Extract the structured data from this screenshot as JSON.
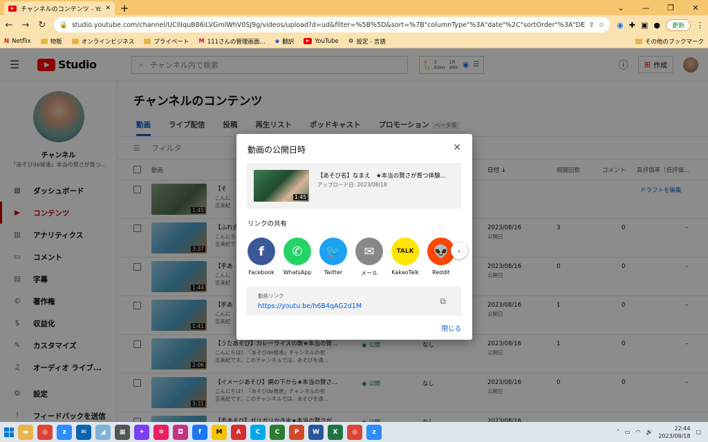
{
  "browser": {
    "tab_title": "チャンネルのコンテンツ - YouTube Stu",
    "new_tab": "+",
    "url": "studio.youtube.com/channel/UCIlIquB86iLVGmlWhV0SJ9g/videos/upload?d=ud&filter=%5B%5D&sort=%7B\"columnType\"%3A\"date\"%2C\"sortOrder\"%3A\"DESCENDING\"%7D&ud...",
    "update_label": "更新",
    "bookmarks": [
      "Netflix",
      "物販",
      "オンラインビジネス",
      "プライベート",
      "111さんの管理画面...",
      "翻訳",
      "YouTube",
      "設定 - 言語"
    ],
    "bookmarks_right": "その他のブックマーク"
  },
  "studio": {
    "logo_text": "Studio",
    "search_placeholder": "チャンネル内で検索",
    "stats": [
      "4",
      "2",
      "18",
      "1y",
      "60m",
      "48h"
    ],
    "create_label": "作成"
  },
  "sidebar": {
    "channel_name": "チャンネル",
    "channel_sub": "『あそびde発達』本当の賢さが育つ...",
    "items": [
      {
        "label": "ダッシュボード",
        "icon": "dashboard-icon"
      },
      {
        "label": "コンテンツ",
        "icon": "content-icon"
      },
      {
        "label": "アナリティクス",
        "icon": "analytics-icon"
      },
      {
        "label": "コメント",
        "icon": "comment-icon"
      },
      {
        "label": "字幕",
        "icon": "subtitles-icon"
      },
      {
        "label": "著作権",
        "icon": "copyright-icon"
      },
      {
        "label": "収益化",
        "icon": "monetization-icon"
      },
      {
        "label": "カスタマイズ",
        "icon": "customize-icon"
      },
      {
        "label": "オーディオ ライブ...",
        "icon": "audio-library-icon"
      },
      {
        "label": "設定",
        "icon": "settings-icon"
      },
      {
        "label": "フィードバックを送信",
        "icon": "feedback-icon"
      }
    ]
  },
  "main": {
    "title": "チャンネルのコンテンツ",
    "tabs": [
      "動画",
      "ライブ配信",
      "投稿",
      "再生リスト",
      "ポッドキャスト",
      "プロモーション"
    ],
    "beta_label": "ベータ版",
    "filter_label": "フィルタ",
    "columns": {
      "video": "動画",
      "date": "日付 ↓",
      "views": "視聴回数",
      "comments": "コメント",
      "rating": "高評価率（低評価..."
    },
    "rows": [
      {
        "title": "【そ",
        "desc": [
          "こんに",
          "吉美紀"
        ],
        "duration": "1:45",
        "visibility": "",
        "restriction": "",
        "date": "",
        "date_sub": "",
        "views": "",
        "comments": "",
        "rating": "",
        "action": "ドラフトを編集"
      },
      {
        "title": "【ふれ合",
        "desc": [
          "こんにち",
          "吉美紀で"
        ],
        "duration": "3:37",
        "visibility": "",
        "restriction": "",
        "date": "2023/08/16",
        "date_sub": "公開日",
        "views": "3",
        "comments": "0",
        "rating": "–",
        "action": ""
      },
      {
        "title": "【手あ",
        "desc": [
          "こんに",
          "吉美紀"
        ],
        "duration": "1:44",
        "visibility": "",
        "restriction": "",
        "date": "2023/08/16",
        "date_sub": "公開日",
        "views": "0",
        "comments": "0",
        "rating": "–",
        "action": ""
      },
      {
        "title": "【手あ",
        "desc": [
          "こんに",
          "吉美紀"
        ],
        "duration": "1:41",
        "visibility": "",
        "restriction": "",
        "date": "2023/08/16",
        "date_sub": "公開日",
        "views": "1",
        "comments": "0",
        "rating": "–",
        "action": ""
      },
      {
        "title": "【うたあそび】カレーライスの歌★本当の賢...",
        "desc": [
          "こんにちは！『あそびde発達』チャンネルの祝",
          "吉美紀です。このチャンネルでは、あそびを通..."
        ],
        "duration": "2:06",
        "visibility": "公開",
        "restriction": "なし",
        "date": "2023/08/16",
        "date_sub": "公開日",
        "views": "1",
        "comments": "0",
        "rating": "–",
        "action": ""
      },
      {
        "title": "【イメージあそび】網の下から★本当の賢さ...",
        "desc": [
          "こんにちは！『あそびde発達』チャンネルの祝",
          "吉美紀です。このチャンネルでは、あそびを通..."
        ],
        "duration": "3:31",
        "visibility": "公開",
        "restriction": "なし",
        "date": "2023/08/16",
        "date_sub": "公開日",
        "views": "0",
        "comments": "0",
        "rating": "–",
        "action": ""
      },
      {
        "title": "【手あそび】ガリガリかき氷★本当の賢さが...",
        "desc": [
          "",
          ""
        ],
        "duration": "",
        "visibility": "公開",
        "restriction": "なし",
        "date": "2023/08/16",
        "date_sub": "",
        "views": "",
        "comments": "",
        "rating": "",
        "action": ""
      }
    ]
  },
  "dialog": {
    "title": "動画の公開日時",
    "video_title": "【あそび名】なまえ　★本当の賢さが育つ体験...",
    "upload_date": "アップロード日: 2023/08/18",
    "duration": "1:45",
    "share_label": "リンクの共有",
    "share": [
      {
        "label": "Facebook",
        "glyph": "f",
        "color": "#3b5998"
      },
      {
        "label": "WhatsApp",
        "glyph": "✆",
        "color": "#25d366"
      },
      {
        "label": "Twitter",
        "glyph": "🐦",
        "color": "#1da1f2"
      },
      {
        "label": "メール",
        "glyph": "✉",
        "color": "#888888"
      },
      {
        "label": "KakaoTalk",
        "glyph": "TALK",
        "color": "#fee500"
      },
      {
        "label": "Reddit",
        "glyph": "👽",
        "color": "#ff4500"
      }
    ],
    "link_label": "動画リンク",
    "link_url": "https://youtu.be/h6B4qAG2d1M",
    "close_label": "閉じる"
  },
  "taskbar": {
    "time": "22:44",
    "date": "2023/08/18"
  }
}
